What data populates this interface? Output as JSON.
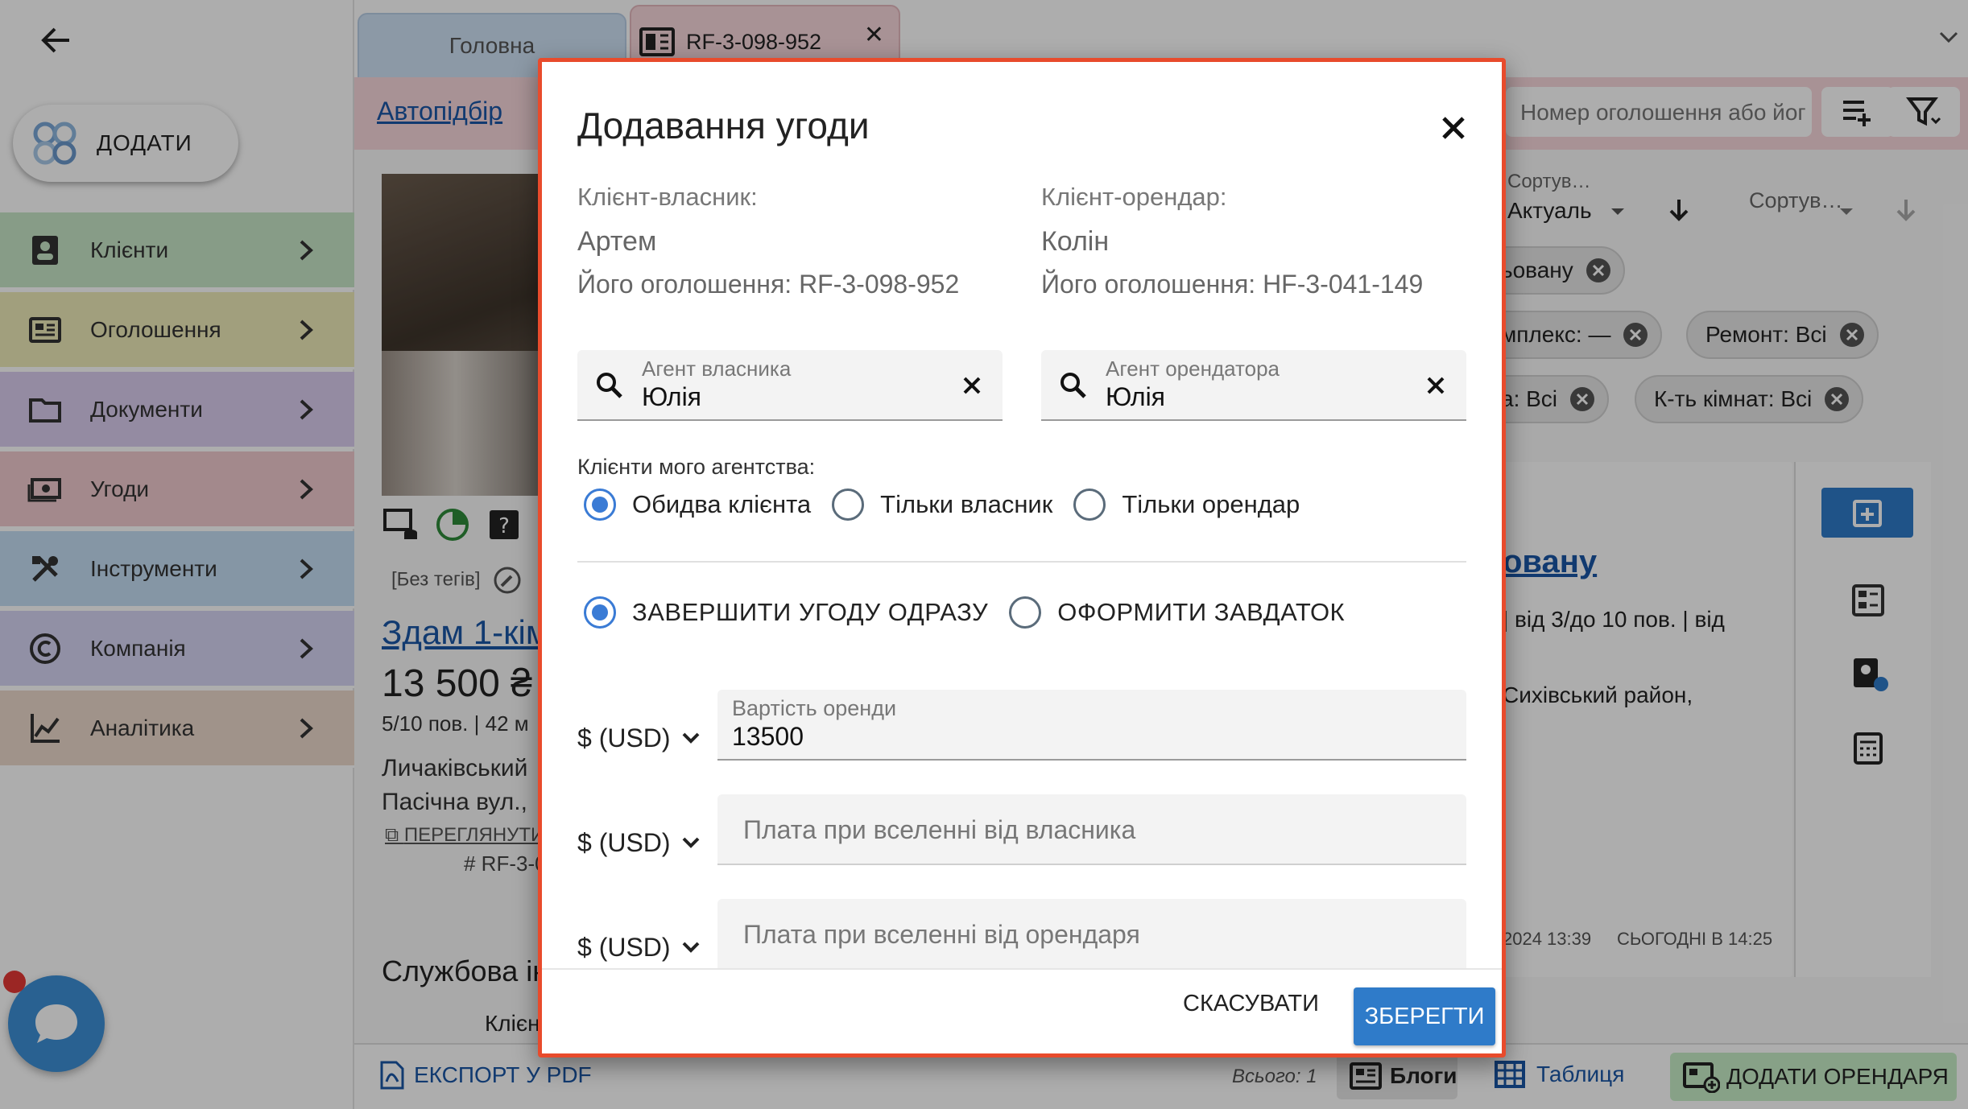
{
  "sidebar": {
    "add_label": "ДОДАТИ",
    "items": [
      {
        "label": "Клієнти",
        "color": "#c7e6c8"
      },
      {
        "label": "Оголошення",
        "color": "#eeebb8"
      },
      {
        "label": "Документи",
        "color": "#dacdef"
      },
      {
        "label": "Угоди",
        "color": "#f1cbcf"
      },
      {
        "label": "Інструменти",
        "color": "#c4ddf3"
      },
      {
        "label": "Компанія",
        "color": "#d6d4f3"
      },
      {
        "label": "Аналітика",
        "color": "#ecd9cc"
      }
    ]
  },
  "tabs": {
    "home": "Головна",
    "ad": "RF-3-098-952"
  },
  "toolbar": {
    "auto_link": "Автопідбір",
    "search_placeholder": "Номер оголошення або йог"
  },
  "listing": {
    "tags": "[Без тегів]",
    "title": "Здам 1-кім",
    "price": "13 500 ₴",
    "floor": "5/10 пов. | 42 м",
    "addr1": "Личаківський",
    "addr2": "Пасічна вул.,",
    "view_link": "ПЕРЕГЛЯНУТИ",
    "id": "# RF-3-0",
    "service_heading": "Службова ін",
    "client_label": "Клієн"
  },
  "right": {
    "sort1_label": "Сортув…",
    "sort1_value": "Актуаль",
    "sort2_label": "Сортув…",
    "chips": [
      "ьовану",
      "мплекс: —",
      "Ремонт: Всі",
      "а: Всі",
      "К-ть кімнат: Всі"
    ],
    "match_link": "овану",
    "match_line1": "| від 3/до 10 пов. | від",
    "match_line2": "Сихівський район,",
    "date1": "2024 13:39",
    "date2": "СЬОГОДНІ В 14:25"
  },
  "footer": {
    "export": "ЕКСПОРТ У PDF",
    "total": "Всього: 1",
    "blogs": "Блоги",
    "table": "Таблиця",
    "add_tenant": "ДОДАТИ ОРЕНДАРЯ"
  },
  "modal": {
    "title": "Додавання угоди",
    "owner": {
      "label": "Клієнт-власник:",
      "name": "Артем",
      "ad": "Його оголошення: RF-3-098-952"
    },
    "tenant": {
      "label": "Клієнт-орендар:",
      "name": "Колін",
      "ad": "Його оголошення: HF-3-041-149"
    },
    "owner_agent": {
      "label": "Агент власника",
      "value": "Юлія"
    },
    "tenant_agent": {
      "label": "Агент орендатора",
      "value": "Юлія"
    },
    "agency_clients_label": "Клієнти мого агентства:",
    "agency_options": [
      "Обидва клієнта",
      "Тільки власник",
      "Тільки орендар"
    ],
    "agency_selected": 0,
    "mode_options": [
      "ЗАВЕРШИТИ УГОДУ ОДРАЗУ",
      "ОФОРМИТИ ЗАВДАТОК"
    ],
    "mode_selected": 0,
    "currency": "$ (USD)",
    "rent": {
      "label": "Вартість оренди",
      "value": "13500"
    },
    "fee_owner_placeholder": "Плата при вселенні від власника",
    "fee_tenant_placeholder": "Плата при вселенні від орендаря",
    "cancel": "СКАСУВАТИ",
    "save": "ЗБЕРЕГТИ"
  },
  "colors": {
    "accent": "#2f7bc9",
    "modal_border": "#e84b2c",
    "link": "#1a56a6"
  }
}
